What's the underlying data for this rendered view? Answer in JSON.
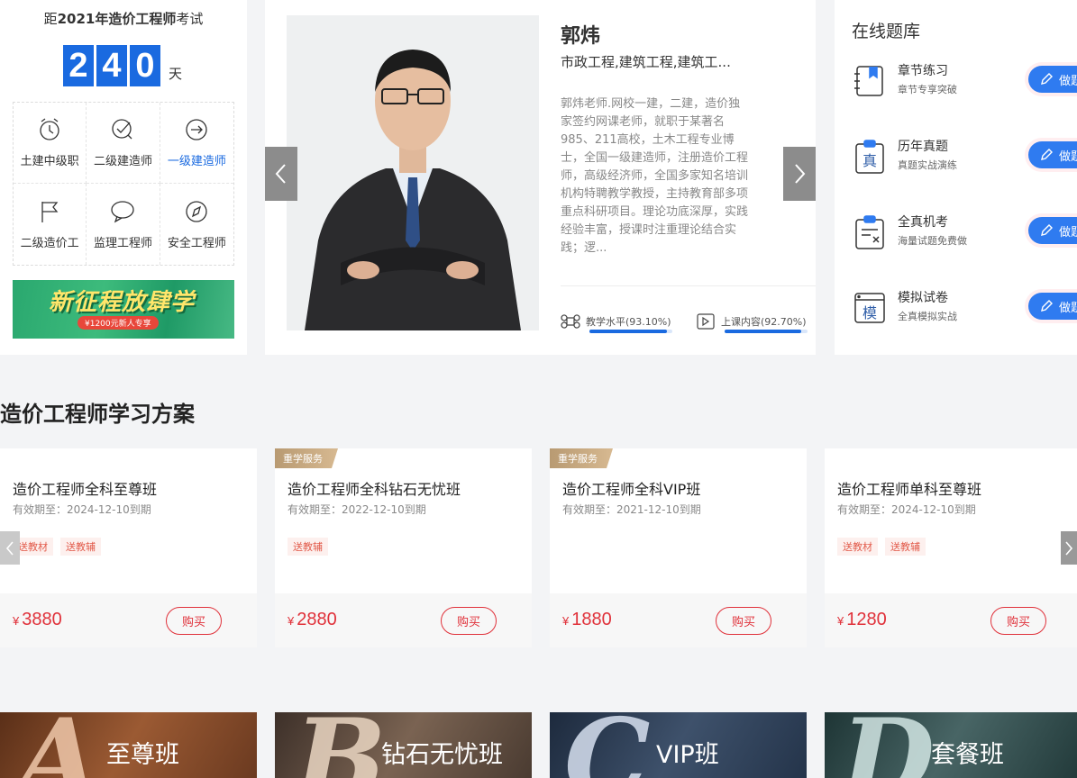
{
  "countdown": {
    "prefix": "距",
    "bold": "2021年造价工程师",
    "suffix": "考试",
    "digits": [
      "2",
      "4",
      "0"
    ],
    "unit": "天"
  },
  "categories": [
    {
      "label": "土建中级职",
      "icon": "alarm-clock-icon"
    },
    {
      "label": "二级建造师",
      "icon": "check-badge-icon"
    },
    {
      "label": "一级建造师",
      "icon": "login-arrow-icon",
      "active": true
    },
    {
      "label": "二级造价工",
      "icon": "flag-icon"
    },
    {
      "label": "监理工程师",
      "icon": "chat-bubble-icon"
    },
    {
      "label": "安全工程师",
      "icon": "compass-icon"
    }
  ],
  "banner": {
    "title": "新征程放肆学",
    "subtitle": "¥1200元新人专享"
  },
  "teacher": {
    "name": "郭炜",
    "subjects": "市政工程,建筑工程,建筑工...",
    "description": "郭炜老师.网校一建，二建，造价独家签约网课老师，就职于某著名985、211高校，土木工程专业博士，全国一级建造师，注册造价工程师，高级经济师，全国多家知名培训机构特聘教学教授，主持教育部多项重点科研项目。理论功底深厚，实践经验丰富，授课时注重理论结合实践；逻...",
    "stats": [
      {
        "label": "教学水平(93.10%)",
        "value": 93.1,
        "icon": "command-icon"
      },
      {
        "label": "上课内容(92.70%)",
        "value": 92.7,
        "icon": "play-icon"
      }
    ]
  },
  "bank": {
    "title": "在线题库",
    "items": [
      {
        "title": "章节练习",
        "sub": "章节专享突破",
        "btn": "做题",
        "icon": "notebook-icon"
      },
      {
        "title": "历年真题",
        "sub": "真题实战演练",
        "btn": "做题",
        "icon": "clipboard-zhen-icon"
      },
      {
        "title": "全真机考",
        "sub": "海量试题免费做",
        "btn": "做题",
        "icon": "clipboard-x-icon"
      },
      {
        "title": "模拟试卷",
        "sub": "全真模拟实战",
        "btn": "做题",
        "icon": "window-mo-icon"
      }
    ]
  },
  "plan": {
    "title": "造价工程师学习方案",
    "cards": [
      {
        "tag": "",
        "name": "造价工程师全科至尊班",
        "valid": "有效期至：2024-12-10到期",
        "gifts": [
          "送教材",
          "送教辅"
        ],
        "currency": "¥",
        "price": "3880",
        "buy": "购买"
      },
      {
        "tag": "重学服务",
        "name": "造价工程师全科钻石无忧班",
        "valid": "有效期至：2022-12-10到期",
        "gifts": [
          "送教辅"
        ],
        "currency": "¥",
        "price": "2880",
        "buy": "购买"
      },
      {
        "tag": "重学服务",
        "name": "造价工程师全科VIP班",
        "valid": "有效期至：2021-12-10到期",
        "gifts": [],
        "currency": "¥",
        "price": "1880",
        "buy": "购买"
      },
      {
        "tag": "",
        "name": "造价工程师单科至尊班",
        "valid": "有效期至：2024-12-10到期",
        "gifts": [
          "送教材",
          "送教辅"
        ],
        "currency": "¥",
        "price": "1280",
        "buy": "购买"
      }
    ]
  },
  "bottom": [
    {
      "letter": "A",
      "label": "至尊班",
      "bg": "#7a4a2c"
    },
    {
      "letter": "B",
      "label": "钻石无忧班",
      "bg": "#5d4a3c"
    },
    {
      "letter": "C",
      "label": "VIP班",
      "bg": "#2b3b52"
    },
    {
      "letter": "D",
      "label": "套餐班",
      "bg": "#2e4a4a"
    }
  ]
}
